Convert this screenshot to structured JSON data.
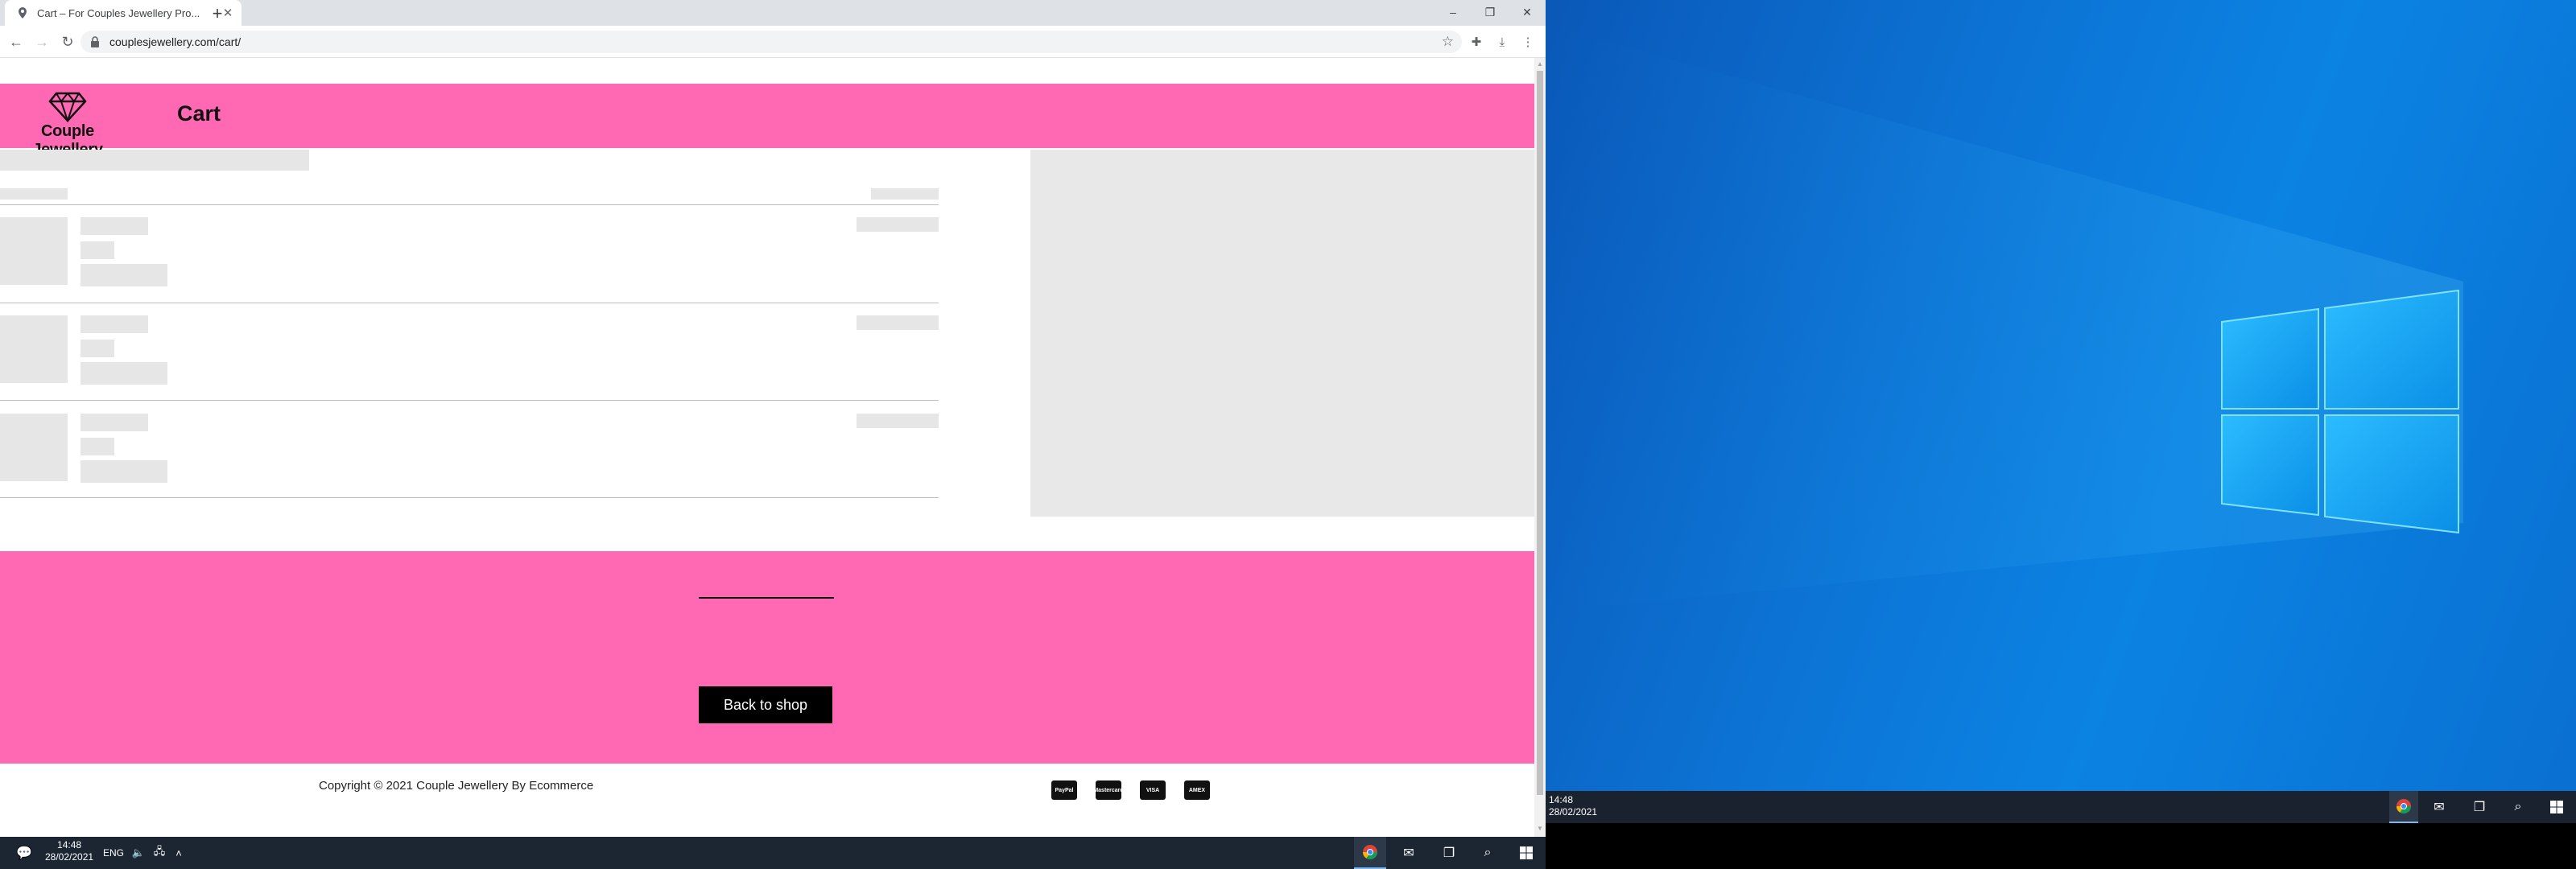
{
  "browser": {
    "tab_title": "Cart – For Couples Jewellery Pro...",
    "url": "couplesjewellery.com/cart/",
    "new_tab": "+",
    "minimize": "–",
    "restore": "❐",
    "close": "✕"
  },
  "site": {
    "brand": "Couple Jewellery",
    "page_title": "Cart",
    "footer_button": "Back to shop",
    "copyright": "Copyright © 2021 Couple Jewellery By",
    "copyright_link": "Ecommerce",
    "payment_icons": [
      "PayPal",
      "Mastercard",
      "VISA",
      "AMEX"
    ]
  },
  "taskbar_left": {
    "time": "14:48",
    "date": "28/02/2021",
    "language": "ENG"
  },
  "taskbar_right": {
    "time": "14:48",
    "date": "28/02/2021"
  },
  "colors": {
    "accent_pink": "#ff69b4",
    "footer_button": "#000000",
    "desktop_blue": "#0b83e3"
  },
  "icons": [
    "location-pin-icon",
    "back-arrow-icon",
    "forward-arrow-icon",
    "reload-icon",
    "lock-icon",
    "star-icon",
    "extensions-icon",
    "download-icon",
    "menu-icon",
    "diamond-logo-icon",
    "chrome-icon",
    "mail-icon",
    "task-view-icon",
    "search-icon",
    "windows-start-icon",
    "windows-logo-icon"
  ]
}
